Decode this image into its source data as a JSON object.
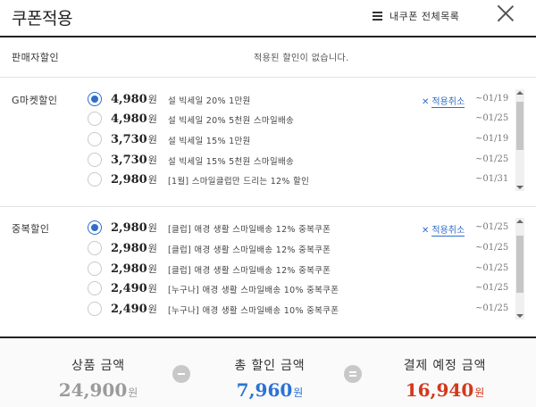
{
  "header": {
    "title": "쿠폰적용",
    "list_button": "내쿠폰 전체목록"
  },
  "seller": {
    "label": "판매자할인",
    "message": "적용된 할인이 없습니다."
  },
  "gmarket": {
    "label": "G마켓할인",
    "coupons": [
      {
        "amount": "4,980",
        "unit": "원",
        "name": "설 빅세일 20% 1만원",
        "cancel": "적용취소",
        "date": "~01/19",
        "selected": true
      },
      {
        "amount": "4,980",
        "unit": "원",
        "name": "설 빅세일 20% 5천원 스마일배송",
        "date": "~01/25",
        "selected": false
      },
      {
        "amount": "3,730",
        "unit": "원",
        "name": "설 빅세일 15% 1만원",
        "date": "~01/19",
        "selected": false
      },
      {
        "amount": "3,730",
        "unit": "원",
        "name": "설 빅세일 15% 5천원 스마일배송",
        "date": "~01/25",
        "selected": false
      },
      {
        "amount": "2,980",
        "unit": "원",
        "name": "[1월] 스마일클럽만 드리는 12% 할인",
        "date": "~01/31",
        "selected": false
      }
    ]
  },
  "duplicate": {
    "label": "중복할인",
    "coupons": [
      {
        "amount": "2,980",
        "unit": "원",
        "name": "[클럽] 애경 생활 스마일배송 12% 중복쿠폰",
        "cancel": "적용취소",
        "date": "~01/25",
        "selected": true
      },
      {
        "amount": "2,980",
        "unit": "원",
        "name": "[클럽] 애경 생활 스마일배송 12% 중복쿠폰",
        "date": "~01/25",
        "selected": false
      },
      {
        "amount": "2,980",
        "unit": "원",
        "name": "[클럽] 애경 생활 스마일배송 12% 중복쿠폰",
        "date": "~01/25",
        "selected": false
      },
      {
        "amount": "2,490",
        "unit": "원",
        "name": "[누구나] 애경 생활 스마일배송 10% 중복쿠폰",
        "date": "~01/25",
        "selected": false
      },
      {
        "amount": "2,490",
        "unit": "원",
        "name": "[누구나] 애경 생활 스마일배송 10% 중복쿠폰",
        "date": "~01/25",
        "selected": false
      }
    ]
  },
  "summary": {
    "product": {
      "label": "상품 금액",
      "value": "24,900",
      "unit": "원"
    },
    "discount": {
      "label": "총 할인 금액",
      "value": "7,960",
      "unit": "원"
    },
    "payment": {
      "label": "결제 예정 금액",
      "value": "16,940",
      "unit": "원"
    }
  },
  "colors": {
    "accent_blue": "#2a73d6",
    "payment_red": "#d3381c",
    "muted_gray": "#9b9b9b"
  }
}
